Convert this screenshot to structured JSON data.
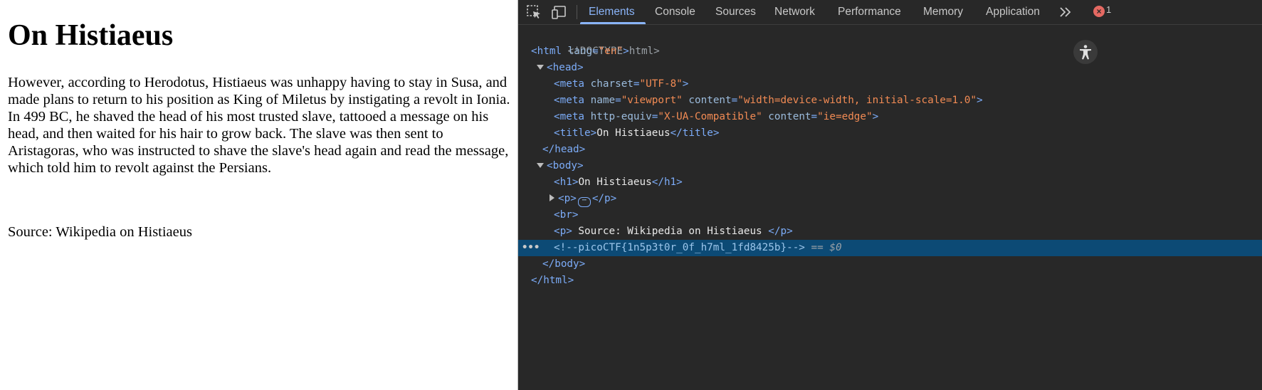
{
  "page": {
    "heading": "On Histiaeus",
    "paragraph": "However, according to Herodotus, Histiaeus was unhappy having to stay in Susa, and made plans to return to his position as King of Miletus by instigating a revolt in Ionia. In 499 BC, he shaved the head of his most trusted slave, tattooed a message on his head, and then waited for his hair to grow back. The slave was then sent to Aristagoras, who was instructed to shave the slave's head again and read the message, which told him to revolt against the Persians.",
    "source": "Source: Wikipedia on Histiaeus"
  },
  "devtools": {
    "tabs": [
      "Elements",
      "Console",
      "Sources",
      "Network",
      "Performance",
      "Memory",
      "Application"
    ],
    "active_tab": "Elements",
    "error_count": "1",
    "dom": {
      "doctype": "<!DOCTYPE html>",
      "html_open": "<html",
      "lang_attr": "lang",
      "lang_val": "\"en\"",
      "gt": ">",
      "head_open": "<head>",
      "meta": "<meta",
      "charset_attr": "charset",
      "charset_val": "\"UTF-8\"",
      "name_attr": "name",
      "name_val": "\"viewport\"",
      "content_attr": "content",
      "content_val1": "\"width=device-width, initial-scale=1.0\"",
      "httpequiv_attr": "http-equiv",
      "httpequiv_val": "\"X-UA-Compatible\"",
      "content_val2": "\"ie=edge\"",
      "title_open": "<title>",
      "title_text": "On Histiaeus",
      "title_close": "</title>",
      "head_close": "</head>",
      "body_open": "<body>",
      "h1_open": "<h1>",
      "h1_text": "On Histiaeus",
      "h1_close": "</h1>",
      "p_open": "<p>",
      "ellipsis": "⋯",
      "p_close": "</p>",
      "br": "<br>",
      "p2_text": " Source: Wikipedia on Histiaeus ",
      "comment": "<!--picoCTF{1n5p3t0r_0f_h7ml_1fd8425b}-->",
      "selected_marker": "== $0",
      "row_dots": "•••",
      "body_close": "</body>",
      "html_close": "</html>",
      "eq": "="
    }
  }
}
